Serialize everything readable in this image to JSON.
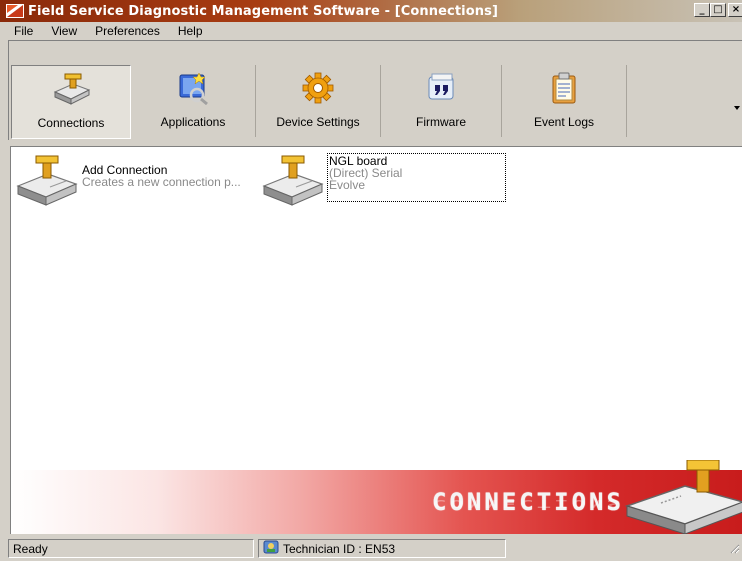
{
  "window": {
    "title": "Field Service Diagnostic Management Software - [Connections]",
    "controls": {
      "minimize": "_",
      "maximize": "□",
      "close": "×"
    }
  },
  "menu": {
    "items": [
      "File",
      "View",
      "Preferences",
      "Help"
    ]
  },
  "toolbar": {
    "buttons": [
      {
        "label": "Connections",
        "icon": "connection-device-icon",
        "pressed": true
      },
      {
        "label": "Applications",
        "icon": "applications-icon",
        "pressed": false
      },
      {
        "label": "Device Settings",
        "icon": "gear-icon",
        "pressed": false
      },
      {
        "label": "Firmware",
        "icon": "firmware-icon",
        "pressed": false
      },
      {
        "label": "Event Logs",
        "icon": "clipboard-icon",
        "pressed": false
      }
    ]
  },
  "connections": {
    "items": [
      {
        "name": "Add Connection",
        "line2": "Creates a new connection p...",
        "line3": "",
        "selected": false
      },
      {
        "name": "NGL board",
        "line2": "(Direct) Serial",
        "line3": "Evolve",
        "selected": true
      }
    ]
  },
  "banner": {
    "text": "CONNECTIONS"
  },
  "status": {
    "ready": "Ready",
    "technician": "Technician ID : EN53"
  },
  "colors": {
    "title_start": "#8a2a0a",
    "banner_red": "#c81c1c",
    "window_face": "#d4d0c8"
  }
}
